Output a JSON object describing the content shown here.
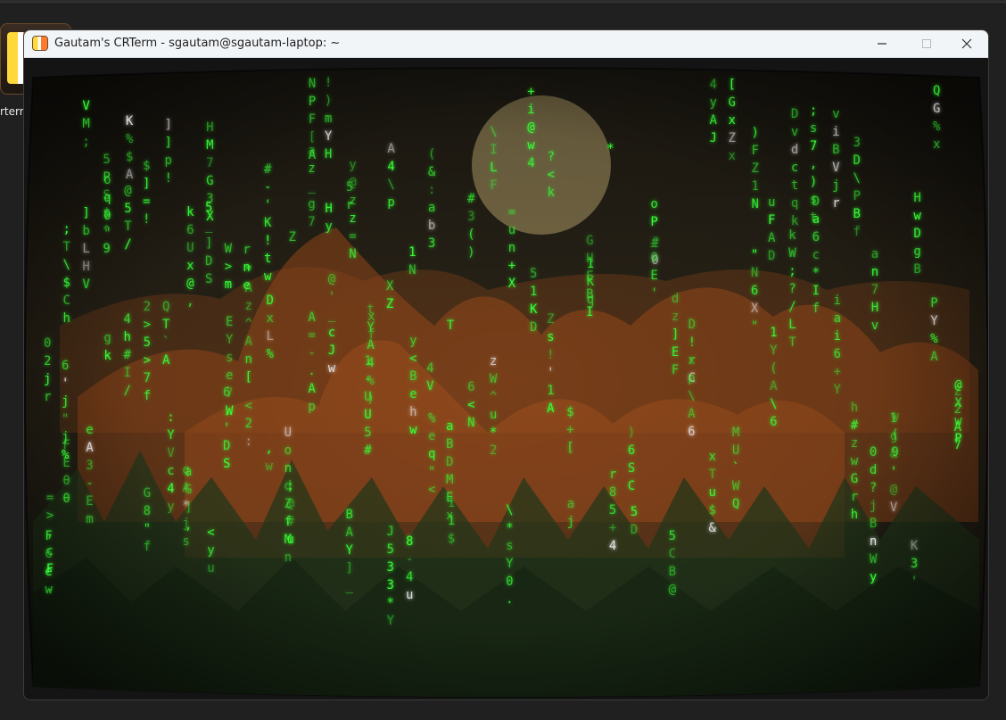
{
  "desktop": {
    "icon_label": "rterm"
  },
  "window": {
    "title": "Gautam's CRTerm - sgautam@sgautam-laptop: ~",
    "controls": {
      "minimize": "minimize-icon",
      "maximize": "maximize-icon",
      "close": "close-icon"
    }
  },
  "terminal": {
    "background": "#2a2318",
    "glyph_color": "#3aff3a",
    "bright_glyph_color": "#e8e8e8",
    "rain_columns": [
      "02jr",
      "FEθθ",
      "VM;",
      "gk",
      "@5T/",
      "G8\"f",
      "]]p!",
      "aG],",
      "<yu",
      "W>m",
      "rne",
      "DxL%",
      ";@#u",
      "az_g7",
      "!)mYH",
      "BAY]_",
      "1-UU5#",
      "J533*Y",
      "y<Behw",
      "(&:ab3",
      "aBDMEx",
      "#3()",
      "\\ILF",
      "=un+X",
      "51KD",
      "?<k",
      "$+[",
      "1Kq",
      "*",
      "5D",
      "#0",
      "5CB@",
      "D!rC",
      "4yAJ",
      "[GxZx",
      "\"N6X\"",
      "uFAD",
      "kW;?/LT",
      "Da6c*If",
      "viBVjr",
      "h#zwGrh",
      "0d?jBnWy",
      "1g&'@V",
      "K3'",
      "PY%A",
      "Z2A7",
      "=>,cF.",
      ";T\\$Ch",
      "eA3-Em",
      "5PS$^9",
      "4h#I/",
      "2>5>7f",
      ":YVc4y",
      "k6Ux@,",
      "HM7G3X",
      "EYse7W",
      "*Az^An[",
      "#-'K!tw",
      "UondZfMn",
      "A=-.Ap",
      "@'_cJw",
      "y@zz=N",
      "tYA4%)",
      "A4\\p",
      "8-4u",
      "%eq\"<",
      "11$",
      "6<N",
      "zW^u*2",
      "\\*sY0.",
      "+i@w4",
      "Zs!'1A",
      "aj",
      "GHEBI",
      "r85+4",
      ")6SC",
      "oP_0E'",
      "dz]EF",
      "xp\\A6",
      "xTu$&",
      "MU`WQ",
      ")FZ1N",
      "1Y(A\\6",
      "Dvdctqk",
      ";s7,)st",
      "iai6+Y",
      "3D\\PBf",
      "an7Hv",
      "w(9",
      "HwDgB",
      "QG%x",
      "@XwP",
      "F6ew",
      "6'j\"j%",
      "]bLHV",
      "oq0\"",
      "K%$A",
      "$]=!",
      "QT`A",
      "qA*js",
      "5_]DS",
      "6,'DS",
      "<2:",
      ",w",
      "Z",
      "NPF[A",
      "Hy",
      "5r",
      "xf",
      "XZ",
      "1N",
      "4V",
      "T"
    ]
  }
}
